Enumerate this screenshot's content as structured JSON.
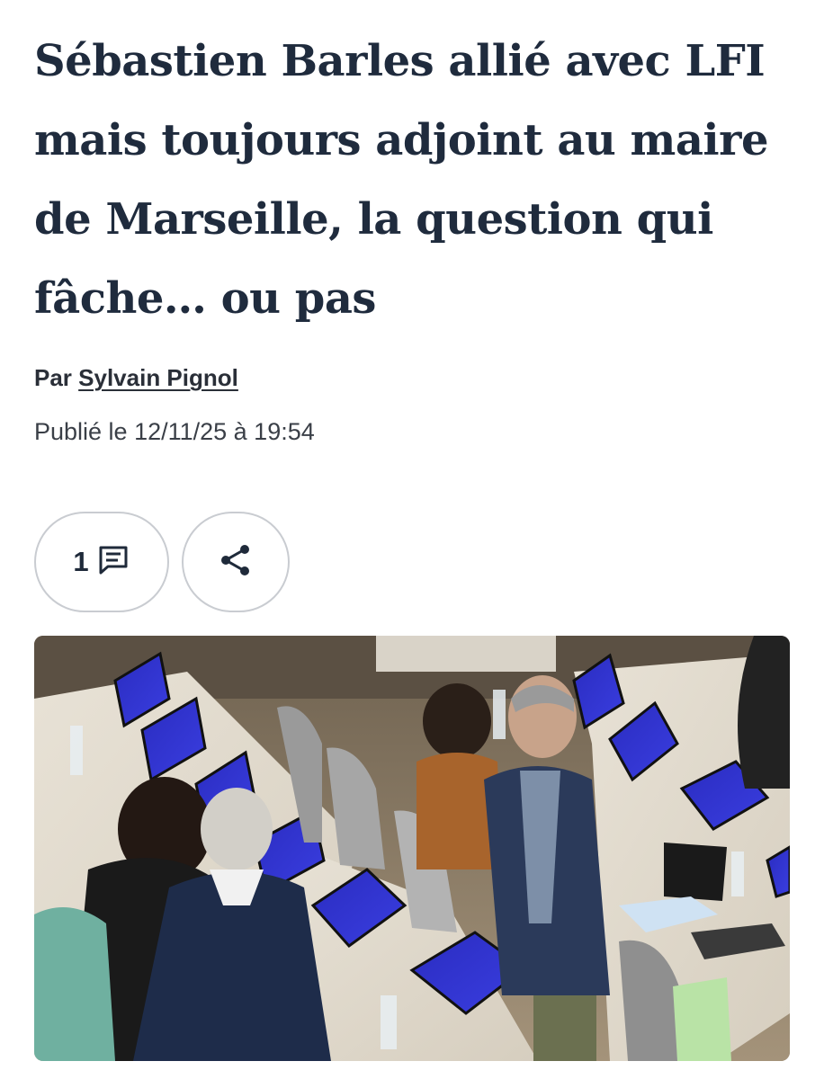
{
  "article": {
    "title": "Sébastien Barles allié avec LFI mais toujours adjoint au maire de Marseille, la question qui fâche… ou pas",
    "byline_prefix": "Par",
    "author": "Sylvain Pignol",
    "published": "Publié le 12/11/25 à 19:54"
  },
  "actions": {
    "comment_count": "1",
    "comment_icon": "comment-icon",
    "share_icon": "share-icon"
  },
  "photo": {
    "description_icon": "photo"
  },
  "colors": {
    "headline": "#1f2b3d",
    "pill_border": "#c9ccd1",
    "screen_blue": "#2d2fc4"
  }
}
